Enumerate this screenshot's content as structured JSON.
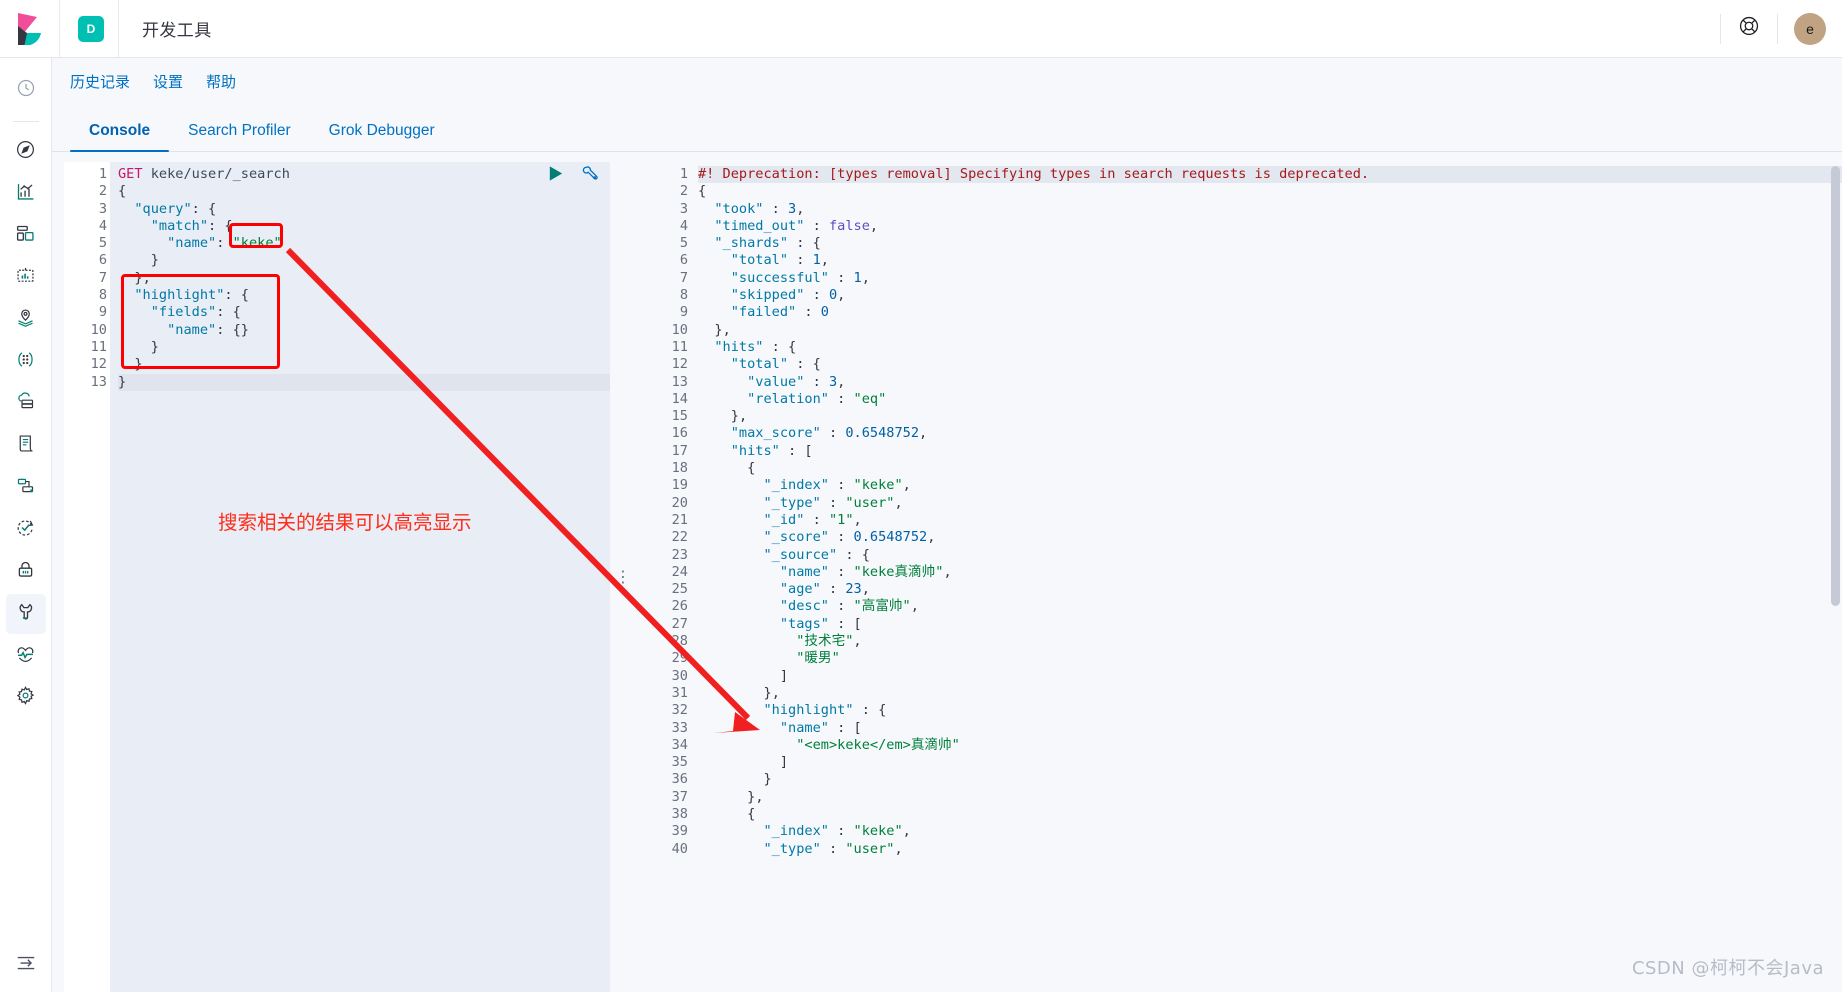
{
  "header": {
    "logo_icon": "kibana-logo-icon",
    "space_badge": "D",
    "title": "开发工具",
    "help_icon": "life-preserver-icon",
    "avatar_initial": "e"
  },
  "rail": {
    "items": [
      {
        "name": "recently-viewed",
        "icon": "clock-icon"
      },
      {
        "name": "discover",
        "icon": "compass-icon"
      },
      {
        "name": "visualize",
        "icon": "chart-icon"
      },
      {
        "name": "dashboard",
        "icon": "dashboard-icon"
      },
      {
        "name": "canvas",
        "icon": "canvas-icon"
      },
      {
        "name": "maps",
        "icon": "map-pin-layers-icon"
      },
      {
        "name": "machine-learning",
        "icon": "ml-nodes-icon"
      },
      {
        "name": "infrastructure",
        "icon": "cloud-server-icon"
      },
      {
        "name": "logs",
        "icon": "document-scroll-icon"
      },
      {
        "name": "apm",
        "icon": "apm-flow-icon"
      },
      {
        "name": "uptime",
        "icon": "uptime-check-icon"
      },
      {
        "name": "siem",
        "icon": "lock-icon"
      },
      {
        "name": "dev-tools",
        "icon": "wrench-icon",
        "active": true
      },
      {
        "name": "monitoring",
        "icon": "heartbeat-icon"
      },
      {
        "name": "management",
        "icon": "gear-icon"
      }
    ],
    "collapse_icon": "collapse-arrow-icon"
  },
  "submenu": {
    "items": [
      {
        "label": "历史记录"
      },
      {
        "label": "设置"
      },
      {
        "label": "帮助"
      }
    ]
  },
  "tabs": [
    {
      "label": "Console",
      "active": true
    },
    {
      "label": "Search Profiler",
      "active": false
    },
    {
      "label": "Grok Debugger",
      "active": false
    }
  ],
  "editor": {
    "play_icon": "play-triangle-icon",
    "wrench_icon": "wrench-icon",
    "lines": [
      {
        "n": 1,
        "fold": "",
        "text": "GET keke/user/_search"
      },
      {
        "n": 2,
        "fold": "▾",
        "text": "{"
      },
      {
        "n": 3,
        "fold": "▾",
        "text": "  \"query\": {"
      },
      {
        "n": 4,
        "fold": "▾",
        "text": "    \"match\": {"
      },
      {
        "n": 5,
        "fold": "",
        "text": "      \"name\": \"keke\""
      },
      {
        "n": 6,
        "fold": "▴",
        "text": "    }"
      },
      {
        "n": 7,
        "fold": "▴",
        "text": "  },"
      },
      {
        "n": 8,
        "fold": "▾",
        "text": "  \"highlight\": {"
      },
      {
        "n": 9,
        "fold": "▾",
        "text": "    \"fields\": {"
      },
      {
        "n": 10,
        "fold": "",
        "text": "      \"name\": {}"
      },
      {
        "n": 11,
        "fold": "▴",
        "text": "    }"
      },
      {
        "n": 12,
        "fold": "▴",
        "text": "  }"
      },
      {
        "n": 13,
        "fold": "▴",
        "text": "}"
      }
    ]
  },
  "output": {
    "lines": [
      {
        "n": 1,
        "fold": "",
        "text": "#! Deprecation: [types removal] Specifying types in search requests is deprecated."
      },
      {
        "n": 2,
        "fold": "▾",
        "text": "{"
      },
      {
        "n": 3,
        "fold": "",
        "text": "  \"took\" : 3,"
      },
      {
        "n": 4,
        "fold": "",
        "text": "  \"timed_out\" : false,"
      },
      {
        "n": 5,
        "fold": "▾",
        "text": "  \"_shards\" : {"
      },
      {
        "n": 6,
        "fold": "",
        "text": "    \"total\" : 1,"
      },
      {
        "n": 7,
        "fold": "",
        "text": "    \"successful\" : 1,"
      },
      {
        "n": 8,
        "fold": "",
        "text": "    \"skipped\" : 0,"
      },
      {
        "n": 9,
        "fold": "",
        "text": "    \"failed\" : 0"
      },
      {
        "n": 10,
        "fold": "▴",
        "text": "  },"
      },
      {
        "n": 11,
        "fold": "▾",
        "text": "  \"hits\" : {"
      },
      {
        "n": 12,
        "fold": "▾",
        "text": "    \"total\" : {"
      },
      {
        "n": 13,
        "fold": "",
        "text": "      \"value\" : 3,"
      },
      {
        "n": 14,
        "fold": "",
        "text": "      \"relation\" : \"eq\""
      },
      {
        "n": 15,
        "fold": "▴",
        "text": "    },"
      },
      {
        "n": 16,
        "fold": "",
        "text": "    \"max_score\" : 0.6548752,"
      },
      {
        "n": 17,
        "fold": "▾",
        "text": "    \"hits\" : ["
      },
      {
        "n": 18,
        "fold": "▾",
        "text": "      {"
      },
      {
        "n": 19,
        "fold": "",
        "text": "        \"_index\" : \"keke\","
      },
      {
        "n": 20,
        "fold": "",
        "text": "        \"_type\" : \"user\","
      },
      {
        "n": 21,
        "fold": "",
        "text": "        \"_id\" : \"1\","
      },
      {
        "n": 22,
        "fold": "",
        "text": "        \"_score\" : 0.6548752,"
      },
      {
        "n": 23,
        "fold": "▾",
        "text": "        \"_source\" : {"
      },
      {
        "n": 24,
        "fold": "",
        "text": "          \"name\" : \"keke真滴帅\","
      },
      {
        "n": 25,
        "fold": "",
        "text": "          \"age\" : 23,"
      },
      {
        "n": 26,
        "fold": "",
        "text": "          \"desc\" : \"高富帅\","
      },
      {
        "n": 27,
        "fold": "▾",
        "text": "          \"tags\" : ["
      },
      {
        "n": 28,
        "fold": "",
        "text": "            \"技术宅\","
      },
      {
        "n": 29,
        "fold": "",
        "text": "            \"暖男\""
      },
      {
        "n": 30,
        "fold": "▴",
        "text": "          ]"
      },
      {
        "n": 31,
        "fold": "▴",
        "text": "        },"
      },
      {
        "n": 32,
        "fold": "▾",
        "text": "        \"highlight\" : {"
      },
      {
        "n": 33,
        "fold": "▾",
        "text": "          \"name\" : ["
      },
      {
        "n": 34,
        "fold": "",
        "text": "            \"<em>keke</em>真滴帅\""
      },
      {
        "n": 35,
        "fold": "▴",
        "text": "          ]"
      },
      {
        "n": 36,
        "fold": "▴",
        "text": "        }"
      },
      {
        "n": 37,
        "fold": "▴",
        "text": "      },"
      },
      {
        "n": 38,
        "fold": "▾",
        "text": "      {"
      },
      {
        "n": 39,
        "fold": "",
        "text": "        \"_index\" : \"keke\","
      },
      {
        "n": 40,
        "fold": "",
        "text": "        \"_type\" : \"user\","
      }
    ]
  },
  "annotations": {
    "note_text": "搜索相关的结果可以高亮显示",
    "note_color": "#ff2d1a",
    "box_color": "#ff0000",
    "arrow_color": "#f02020"
  },
  "watermark": "CSDN @柯柯不会Java",
  "colors": {
    "accent": "#0071c2",
    "teal": "#00bfb3",
    "editor_bg": "#e9edf5",
    "output_bg": "#f7f8fc",
    "avatar_bg": "#bfa383"
  }
}
